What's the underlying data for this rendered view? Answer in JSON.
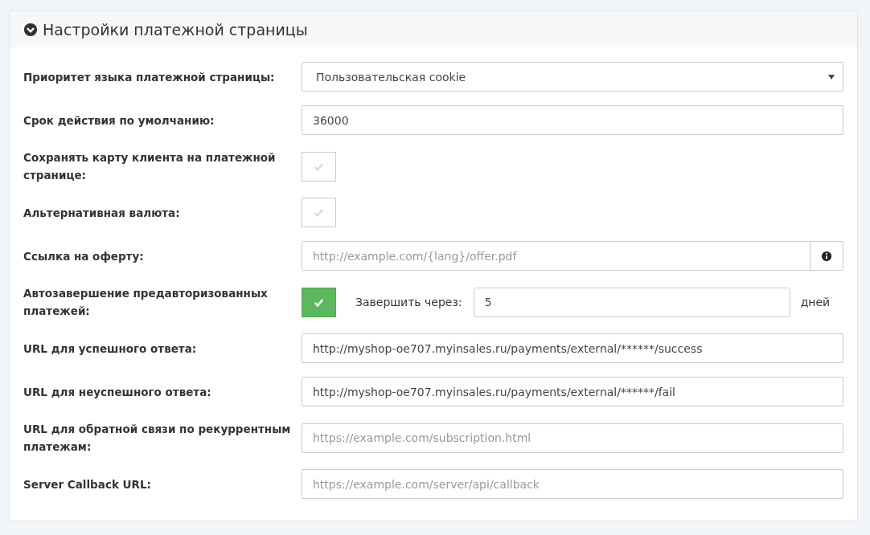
{
  "panel": {
    "title": "Настройки платежной страницы",
    "expanded": true
  },
  "rows": [
    {
      "kind": "select",
      "label": "Приоритет языка платежной страницы:",
      "value": "Пользовательская cookie"
    },
    {
      "kind": "text",
      "label": "Срок действия по умолчанию:",
      "value": "36000"
    },
    {
      "kind": "checkbox",
      "label": "Сохранять карту клиента на платежной странице:",
      "checked": false
    },
    {
      "kind": "checkbox",
      "label": "Альтернативная валюта:",
      "checked": false
    },
    {
      "kind": "addon",
      "label": "Ссылка на оферту:",
      "placeholder": "http://example.com/{lang}/offer.pdf"
    },
    {
      "kind": "delay",
      "label": "Автозавершение предавторизованных платежей:",
      "checked": true,
      "inline_label": "Завершить через:",
      "value": "5",
      "unit": "дней"
    },
    {
      "kind": "text",
      "label": "URL для успешного ответа:",
      "value": "http://myshop-oe707.myinsales.ru/payments/external/******/success"
    },
    {
      "kind": "text",
      "label": "URL для неуспешного ответа:",
      "value": "http://myshop-oe707.myinsales.ru/payments/external/******/fail"
    },
    {
      "kind": "text",
      "label": "URL для обратной связи по рекуррентным платежам:",
      "placeholder": "https://example.com/subscription.html"
    },
    {
      "kind": "text",
      "label": "Server Callback URL:",
      "placeholder": "https://example.com/server/api/callback"
    }
  ]
}
